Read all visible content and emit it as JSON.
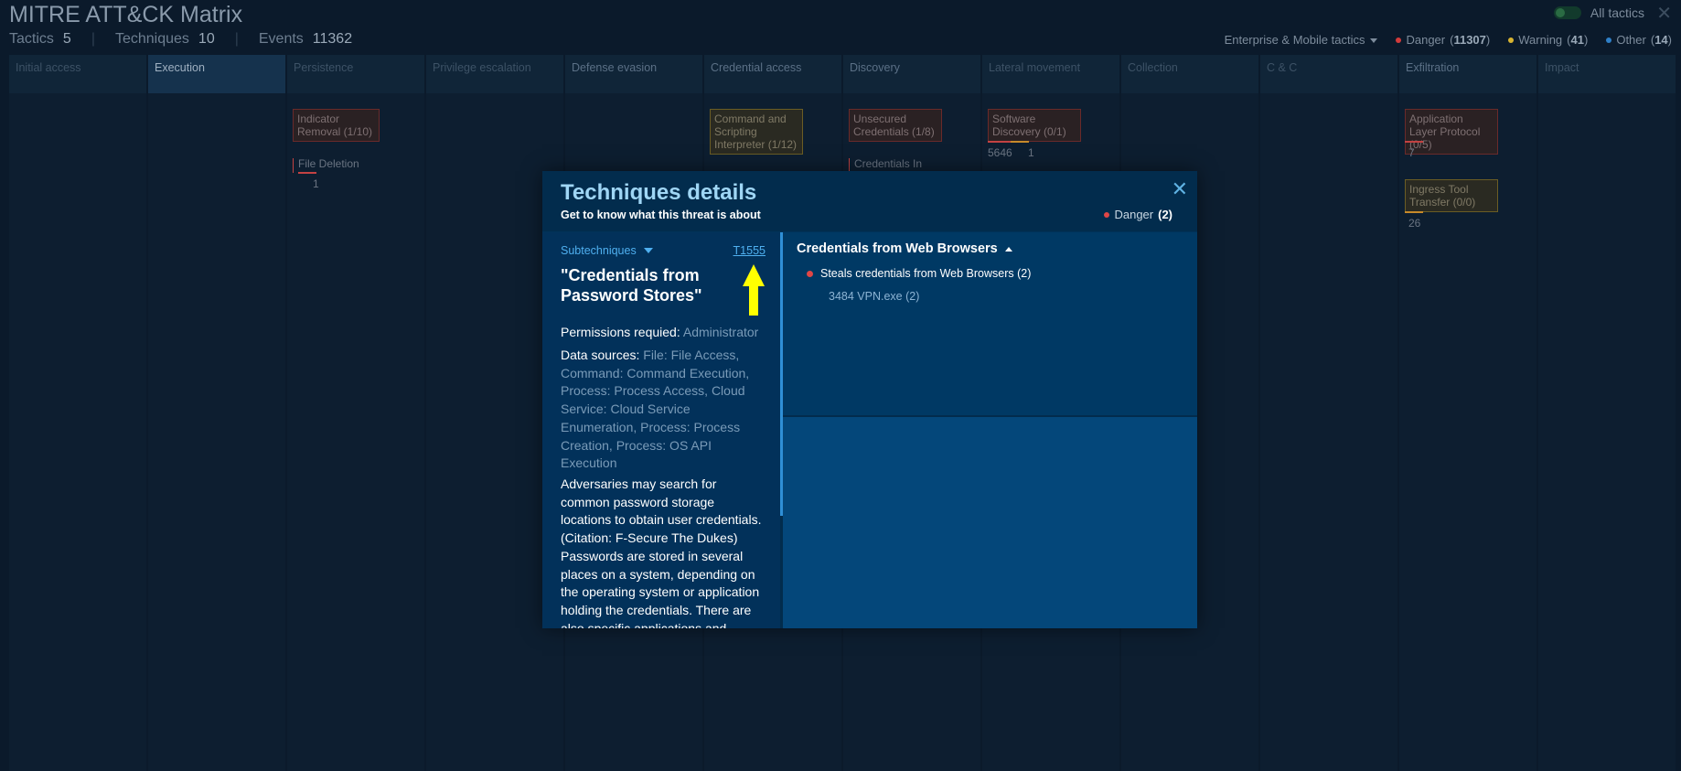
{
  "app": {
    "title": "MITRE ATT&CK Matrix"
  },
  "stats": [
    {
      "label": "Tactics",
      "value": "5"
    },
    {
      "label": "Techniques",
      "value": "10"
    },
    {
      "label": "Events",
      "value": "11362"
    }
  ],
  "toggle": {
    "label": "All tactics"
  },
  "filters": {
    "dropdown": "Enterprise & Mobile tactics",
    "legend": [
      {
        "label": "Danger",
        "count": "11307",
        "color": "#d33b3b"
      },
      {
        "label": "Warning",
        "count": "41",
        "color": "#d8b431"
      },
      {
        "label": "Other",
        "count": "14",
        "color": "#2f80c8"
      }
    ]
  },
  "tactics": [
    "Initial access",
    "Execution",
    "Persistence",
    "Privilege escalation",
    "Defense evasion",
    "Credential access",
    "Discovery",
    "Lateral movement",
    "Collection",
    "C & C",
    "Exfiltration",
    "Impact"
  ],
  "cards": {
    "persistence": {
      "title": "Indicator Removal (1/10)",
      "sub": "File Deletion",
      "sub_count": "1"
    },
    "credential": {
      "title": "Command and Scripting Interpreter (1/12)"
    },
    "discovery": {
      "title": "Unsecured Credentials (1/8)",
      "sub": "Credentials In"
    },
    "lateral": {
      "title": "Software Discovery (0/1)",
      "count_a": "5646",
      "count_b": "1"
    },
    "exfil1": {
      "title": "Application Layer Protocol (0/5)",
      "count": "7"
    },
    "exfil2": {
      "title": "Ingress Tool Transfer (0/0)",
      "count": "26"
    }
  },
  "modal": {
    "title": "Techniques details",
    "subtitle": "Get to know what this threat is about",
    "badge_label": "Danger",
    "badge_count": "(2)",
    "subtechniques_label": "Subtechniques",
    "technique_id": "T1555",
    "technique_name": "\"Credentials from Password Stores\"",
    "permissions_label": "Permissions requied:",
    "permissions_value": "Administrator",
    "data_sources_label": "Data sources:",
    "data_sources_value": "File: File Access, Command: Command Execution, Process: Process Access, Cloud Service: Cloud Service Enumeration, Process: Process Creation, Process: OS API Execution",
    "description": "Adversaries may search for common password storage locations to obtain user credentials. (Citation: F-Secure The Dukes) Passwords are stored in several places on a system, depending on the operating system or application holding the credentials. There are also specific applications and",
    "right": {
      "header": "Credentials from Web Browsers",
      "item": "Steals credentials from Web Browsers (2)",
      "process": "3484 VPN.exe (2)"
    }
  }
}
